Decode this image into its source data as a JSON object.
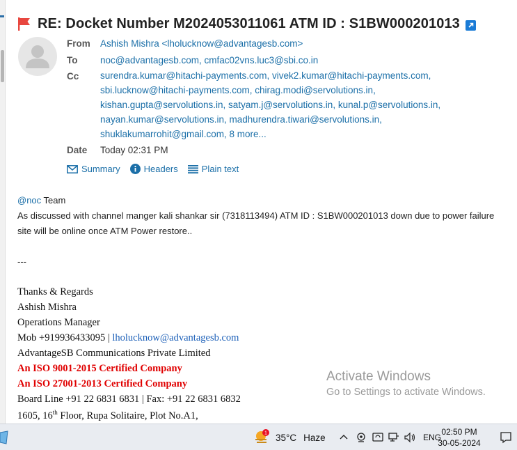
{
  "email": {
    "subject": "RE: Docket Number M2024053011061 ATM ID : S1BW000201013",
    "labels": {
      "from": "From",
      "to": "To",
      "cc": "Cc",
      "date": "Date"
    },
    "from": "Ashish Mishra <lholucknow@advantagesb.com>",
    "to": "noc@advantagesb.com, cmfac02vns.luc3@sbi.co.in",
    "cc_lines": [
      "surendra.kumar@hitachi-payments.com, vivek2.kumar@hitachi-payments.com,",
      "sbi.lucknow@hitachi-payments.com, chirag.modi@servolutions.in,",
      "kishan.gupta@servolutions.in, satyam.j@servolutions.in, kunal.p@servolutions.in,",
      "nayan.kumar@servolutions.in, madhurendra.tiwari@servolutions.in,",
      "shuklakumarrohit@gmail.com, 8 more..."
    ],
    "date": "Today 02:31 PM",
    "header_links": {
      "summary": "Summary",
      "headers": "Headers",
      "plain_text": "Plain text"
    },
    "body": {
      "mention": "@noc",
      "greeting_rest": " Team",
      "line1": "As discussed with channel manger kali shankar sir (7318113494) ATM ID : S1BW000201013 down due to power failure",
      "line2": "site will be online once ATM Power restore..",
      "separator": "---"
    },
    "signature": {
      "thanks": "Thanks & Regards",
      "name": "Ashish Mishra",
      "title": "Operations Manager",
      "mob_prefix": "Mob +919936433095 | ",
      "mob_email": "lholucknow@advantagesb.com",
      "company": "AdvantageSB Communications Private Limited",
      "iso1": "An ISO 9001-2015 Certified Company",
      "iso2": "An ISO 27001-2013 Certified Company",
      "board": "Board Line +91 22 6831 6831 | Fax: +91 22 6831 6832",
      "addr_pre": "1605, 16",
      "addr_sup": "th",
      "addr_post": " Floor, Rupa Solitaire, Plot No.A1,"
    }
  },
  "watermark": {
    "title": "Activate Windows",
    "subtitle": "Go to Settings to activate Windows."
  },
  "taskbar": {
    "weather_badge": "1",
    "temperature": "35°C",
    "condition": "Haze",
    "language": "ENG",
    "time": "02:50 PM",
    "date": "30-05-2024"
  },
  "colors": {
    "link": "#1b6fa8",
    "flag": "#e8473f",
    "iso_red": "#e00000"
  }
}
